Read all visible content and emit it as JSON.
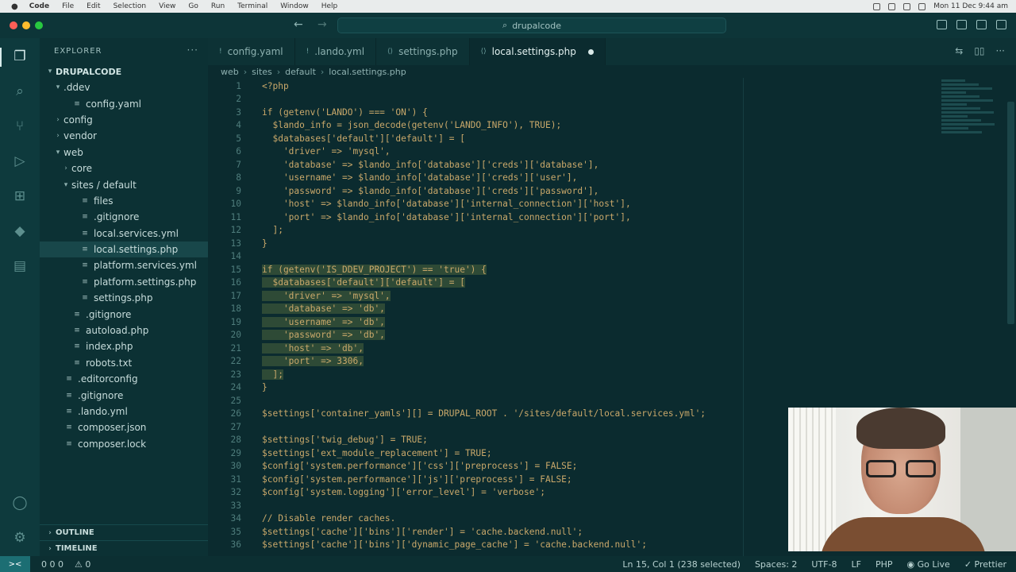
{
  "menubar": {
    "items": [
      "Code",
      "File",
      "Edit",
      "Selection",
      "View",
      "Go",
      "Run",
      "Terminal",
      "Window",
      "Help"
    ],
    "clock": "Mon 11 Dec 9:44 am"
  },
  "window": {
    "title": "drupalcode"
  },
  "sidebar": {
    "header": "EXPLORER",
    "root": "DRUPALCODE",
    "tree": [
      {
        "label": ".ddev",
        "indent": 1,
        "kind": "folder-open"
      },
      {
        "label": "config.yaml",
        "indent": 2,
        "kind": "file"
      },
      {
        "label": "config",
        "indent": 1,
        "kind": "folder"
      },
      {
        "label": "vendor",
        "indent": 1,
        "kind": "folder"
      },
      {
        "label": "web",
        "indent": 1,
        "kind": "folder-open"
      },
      {
        "label": "core",
        "indent": 2,
        "kind": "folder"
      },
      {
        "label": "sites / default",
        "indent": 2,
        "kind": "folder-open"
      },
      {
        "label": "files",
        "indent": 3,
        "kind": "file"
      },
      {
        "label": ".gitignore",
        "indent": 3,
        "kind": "file"
      },
      {
        "label": "local.services.yml",
        "indent": 3,
        "kind": "file"
      },
      {
        "label": "local.settings.php",
        "indent": 3,
        "kind": "file",
        "selected": true
      },
      {
        "label": "platform.services.yml",
        "indent": 3,
        "kind": "file"
      },
      {
        "label": "platform.settings.php",
        "indent": 3,
        "kind": "file"
      },
      {
        "label": "settings.php",
        "indent": 3,
        "kind": "file"
      },
      {
        "label": ".gitignore",
        "indent": 2,
        "kind": "file"
      },
      {
        "label": "autoload.php",
        "indent": 2,
        "kind": "file"
      },
      {
        "label": "index.php",
        "indent": 2,
        "kind": "file"
      },
      {
        "label": "robots.txt",
        "indent": 2,
        "kind": "file"
      },
      {
        "label": ".editorconfig",
        "indent": 1,
        "kind": "file"
      },
      {
        "label": ".gitignore",
        "indent": 1,
        "kind": "file"
      },
      {
        "label": ".lando.yml",
        "indent": 1,
        "kind": "file"
      },
      {
        "label": "composer.json",
        "indent": 1,
        "kind": "file"
      },
      {
        "label": "composer.lock",
        "indent": 1,
        "kind": "file"
      }
    ],
    "outline": "OUTLINE",
    "timeline": "TIMELINE"
  },
  "tabs": [
    {
      "label": "config.yaml",
      "active": false
    },
    {
      "label": ".lando.yml",
      "active": false
    },
    {
      "label": "settings.php",
      "active": false
    },
    {
      "label": "local.settings.php",
      "active": true,
      "dirty": true
    }
  ],
  "breadcrumb": [
    "web",
    "sites",
    "default",
    "local.settings.php"
  ],
  "code": [
    {
      "n": "1",
      "t": "<?php"
    },
    {
      "n": "2",
      "t": ""
    },
    {
      "n": "3",
      "t": "if (getenv('LANDO') === 'ON') {"
    },
    {
      "n": "4",
      "t": "  $lando_info = json_decode(getenv('LANDO_INFO'), TRUE);"
    },
    {
      "n": "5",
      "t": "  $databases['default']['default'] = ["
    },
    {
      "n": "6",
      "t": "    'driver' => 'mysql',"
    },
    {
      "n": "7",
      "t": "    'database' => $lando_info['database']['creds']['database'],"
    },
    {
      "n": "8",
      "t": "    'username' => $lando_info['database']['creds']['user'],"
    },
    {
      "n": "9",
      "t": "    'password' => $lando_info['database']['creds']['password'],"
    },
    {
      "n": "10",
      "t": "    'host' => $lando_info['database']['internal_connection']['host'],"
    },
    {
      "n": "11",
      "t": "    'port' => $lando_info['database']['internal_connection']['port'],"
    },
    {
      "n": "12",
      "t": "  ];"
    },
    {
      "n": "13",
      "t": "}"
    },
    {
      "n": "14",
      "t": ""
    },
    {
      "n": "15",
      "t": "if (getenv('IS_DDEV_PROJECT') == 'true') {",
      "sel": true
    },
    {
      "n": "16",
      "t": "  $databases['default']['default'] = [",
      "sel": true
    },
    {
      "n": "17",
      "t": "    'driver' => 'mysql',",
      "sel": true
    },
    {
      "n": "18",
      "t": "    'database' => 'db',",
      "sel": true
    },
    {
      "n": "19",
      "t": "    'username' => 'db',",
      "sel": true
    },
    {
      "n": "20",
      "t": "    'password' => 'db',",
      "sel": true
    },
    {
      "n": "21",
      "t": "    'host' => 'db',",
      "sel": true
    },
    {
      "n": "22",
      "t": "    'port' => 3306,",
      "sel": true
    },
    {
      "n": "23",
      "t": "  ];",
      "sel": true
    },
    {
      "n": "24",
      "t": "}"
    },
    {
      "n": "25",
      "t": ""
    },
    {
      "n": "26",
      "t": "$settings['container_yamls'][] = DRUPAL_ROOT . '/sites/default/local.services.yml';"
    },
    {
      "n": "27",
      "t": ""
    },
    {
      "n": "28",
      "t": "$settings['twig_debug'] = TRUE;"
    },
    {
      "n": "29",
      "t": "$settings['ext_module_replacement'] = TRUE;"
    },
    {
      "n": "30",
      "t": "$config['system.performance']['css']['preprocess'] = FALSE;"
    },
    {
      "n": "31",
      "t": "$config['system.performance']['js']['preprocess'] = FALSE;"
    },
    {
      "n": "32",
      "t": "$config['system.logging']['error_level'] = 'verbose';"
    },
    {
      "n": "33",
      "t": ""
    },
    {
      "n": "34",
      "t": "// Disable render caches."
    },
    {
      "n": "35",
      "t": "$settings['cache']['bins']['render'] = 'cache.backend.null';"
    },
    {
      "n": "36",
      "t": "$settings['cache']['bins']['dynamic_page_cache'] = 'cache.backend.null';"
    }
  ],
  "status": {
    "branch_info": "0  0  0",
    "warnings": "0",
    "cursor": "Ln 15, Col 1 (238 selected)",
    "spaces": "Spaces: 2",
    "encoding": "UTF-8",
    "eol": "LF",
    "language": "PHP",
    "golive": "Go Live",
    "prettier": "Prettier"
  }
}
